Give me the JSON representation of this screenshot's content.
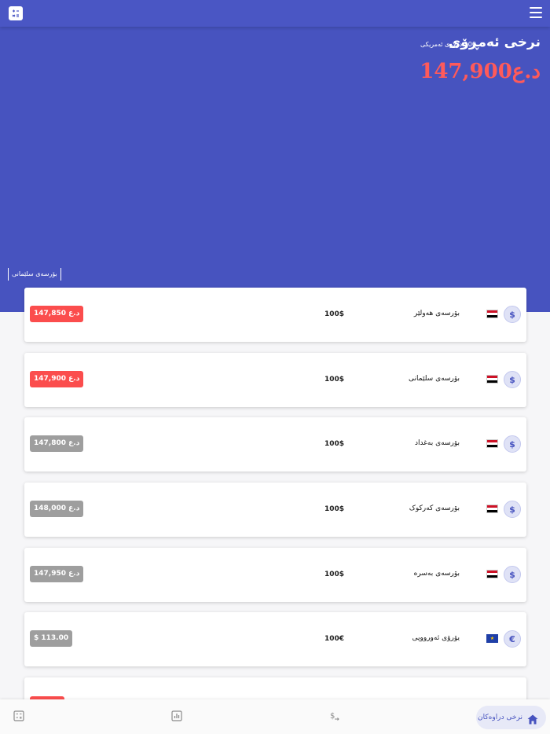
{
  "header": {
    "calculator_icon": "calculator-icon",
    "menu_icon": "hamburger-menu-icon"
  },
  "hero": {
    "title": "نرخی ئەمڕۆی",
    "subtitle": "100 دۆلاری ئەمریکی",
    "price": "147,900د.ع",
    "tab_label": "بۆرسەی سلێمانی"
  },
  "exchanges": [
    {
      "name": "بۆرسەی هەولێر",
      "amount": "100$",
      "price": "147,850 د.ع",
      "badge_color": "#fb4d4d",
      "flag": "iraq",
      "coin": "$"
    },
    {
      "name": "بۆرسەی سلێمانی",
      "amount": "100$",
      "price": "147,900 د.ع",
      "badge_color": "#fb4d4d",
      "flag": "iraq",
      "coin": "$"
    },
    {
      "name": "بۆرسەی بەغداد",
      "amount": "100$",
      "price": "147,800 د.ع",
      "badge_color": "#9e9e9e",
      "flag": "iraq",
      "coin": "$"
    },
    {
      "name": "بۆرسەی کەرکوک",
      "amount": "100$",
      "price": "148,000 د.ع",
      "badge_color": "#9e9e9e",
      "flag": "iraq",
      "coin": "$"
    },
    {
      "name": "بۆرسەی بەسرە",
      "amount": "100$",
      "price": "147,950 د.ع",
      "badge_color": "#9e9e9e",
      "flag": "iraq",
      "coin": "$"
    },
    {
      "name": "یۆرۆی ئەورووپی",
      "amount": "100€",
      "price": "$ 113.00",
      "badge_color": "#9e9e9e",
      "flag": "eu",
      "coin": "€"
    }
  ],
  "bottom_nav": {
    "active_label": "نرخی دراوەکان",
    "items": [
      "calculator-icon",
      "chart-icon",
      "currency-exchange-icon",
      "home-icon"
    ]
  }
}
